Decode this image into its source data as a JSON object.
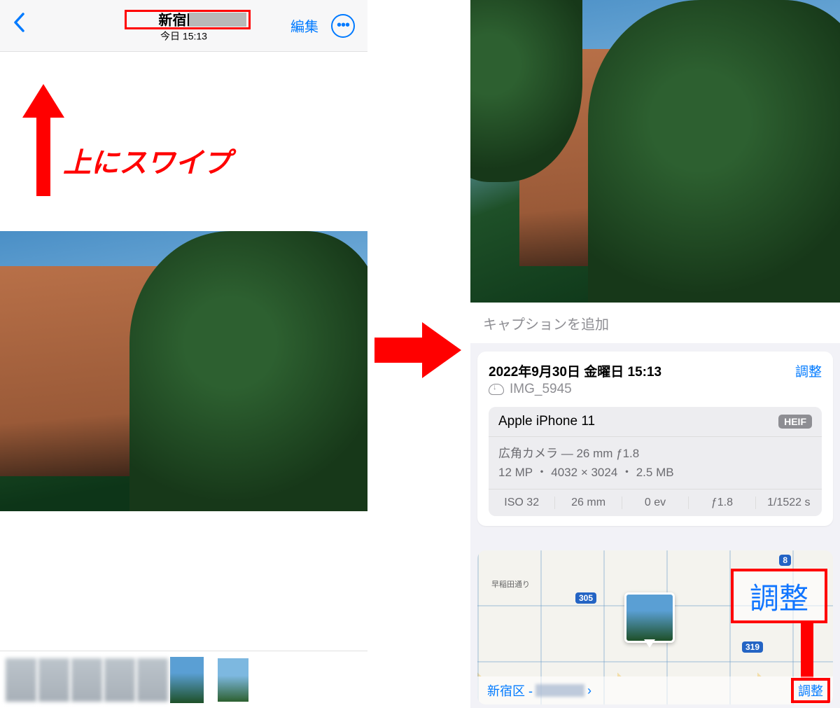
{
  "left": {
    "nav": {
      "title_location": "新宿区 -",
      "subtitle": "今日 15:13",
      "edit_label": "編集"
    },
    "instruction": "上にスワイプ"
  },
  "right": {
    "caption_placeholder": "キャプションを追加",
    "info": {
      "datetime": "2022年9月30日 金曜日 15:13",
      "adjust_label": "調整",
      "filename": "IMG_5945"
    },
    "device": {
      "name": "Apple iPhone 11",
      "format_badge": "HEIF",
      "lens": "広角カメラ — 26 mm ƒ1.8",
      "specs": "12 MP ・ 4032 × 3024 ・ 2.5 MB",
      "exif": {
        "iso": "ISO 32",
        "focal": "26 mm",
        "ev": "0 ev",
        "aperture": "ƒ1.8",
        "shutter": "1/1522 s"
      }
    },
    "map": {
      "adjust_big_label": "調整",
      "location_prefix": "新宿区 -",
      "adjust_small_label": "調整",
      "road_label": "早稲田通り",
      "route_305": "305",
      "route_8": "8",
      "route_319": "319"
    }
  }
}
